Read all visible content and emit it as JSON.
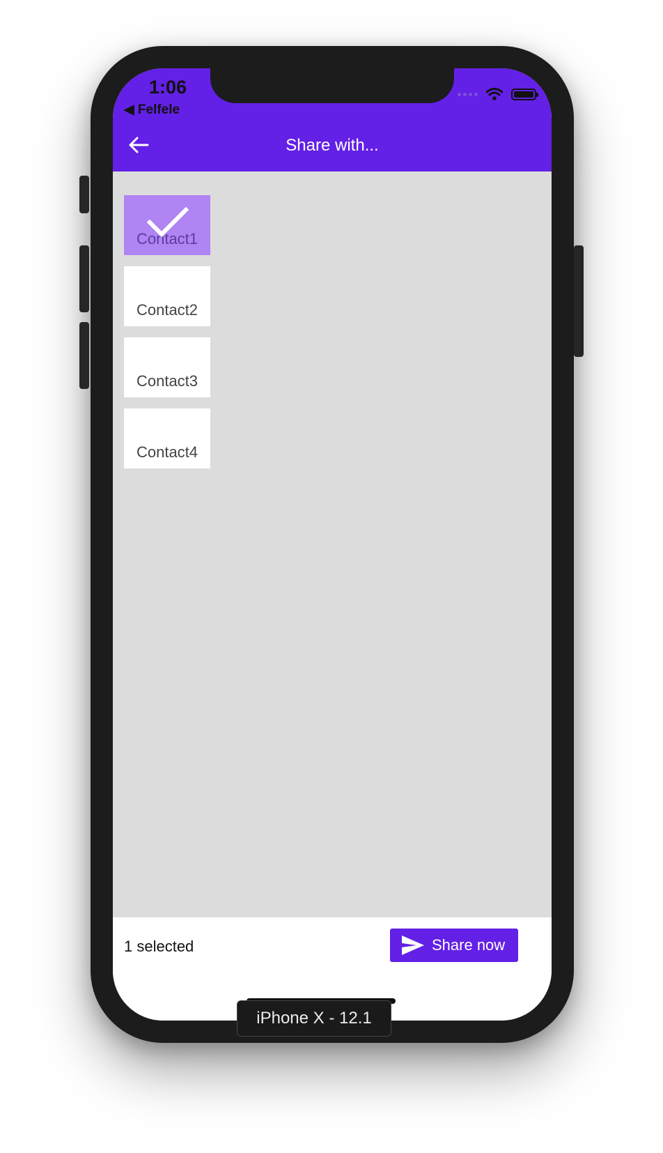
{
  "status_bar": {
    "time": "1:06",
    "back_app": "◀ Felfele",
    "icons": [
      "signal-dots-icon",
      "wifi-icon",
      "battery-icon"
    ]
  },
  "header": {
    "back_icon": "arrow-left-icon",
    "title": "Share with..."
  },
  "contacts": [
    {
      "label": "Contact1",
      "selected": true
    },
    {
      "label": "Contact2",
      "selected": false
    },
    {
      "label": "Contact3",
      "selected": false
    },
    {
      "label": "Contact4",
      "selected": false
    }
  ],
  "footer": {
    "selected_text": "1 selected",
    "share_button": {
      "label": "Share now",
      "icon": "send-icon"
    }
  },
  "device_label": "iPhone X - 12.1",
  "colors": {
    "primary": "#6320e6",
    "selected_tile": "#b084f2",
    "background": "#dcdcdc",
    "tile": "#ffffff"
  }
}
